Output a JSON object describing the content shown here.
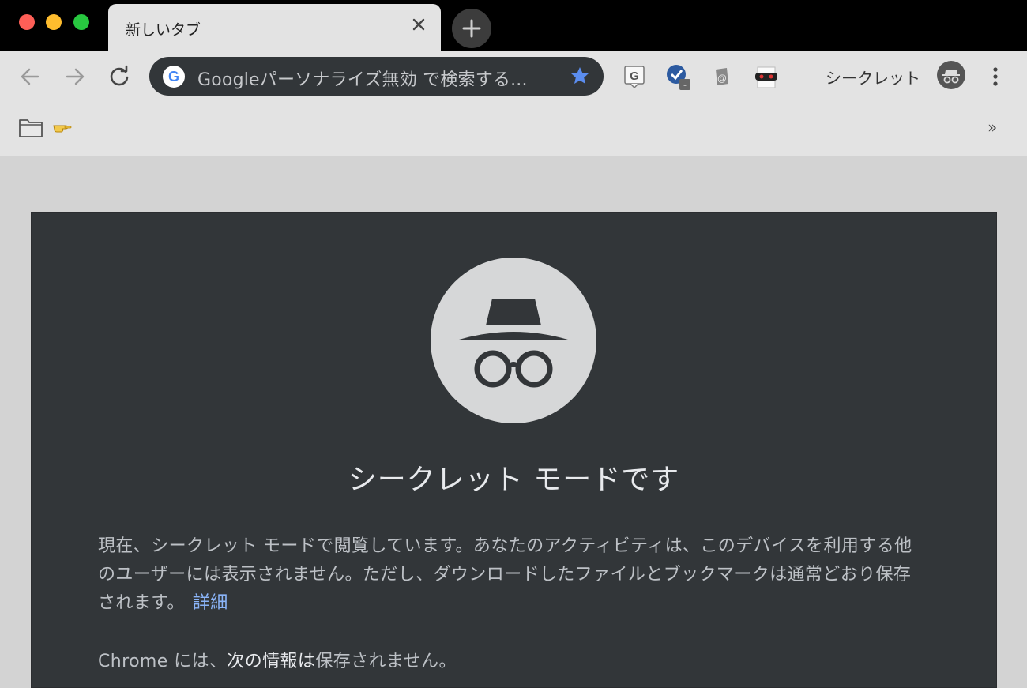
{
  "tab": {
    "title": "新しいタブ"
  },
  "omnibox": {
    "text": "Googleパーソナライズ無効 で検索する..."
  },
  "toolbar": {
    "incognito_label": "シークレット"
  },
  "bookmarks": {
    "more_label": "»"
  },
  "incognito_page": {
    "heading": "シークレット モードです",
    "para1": "現在、シークレット モードで閲覧しています。あなたのアクティビティは、このデバイスを利用する他のユーザーには表示されません。ただし、ダウンロードしたファイルとブックマークは通常どおり保存されます。",
    "learn_more": "詳細",
    "para2_prefix": "Chrome には、",
    "para2_bold": "次の情報は",
    "para2_suffix": "保存されません。"
  },
  "colors": {
    "accent": "#8ab4f8",
    "star": "#5b8def",
    "page_bg": "#323639"
  }
}
